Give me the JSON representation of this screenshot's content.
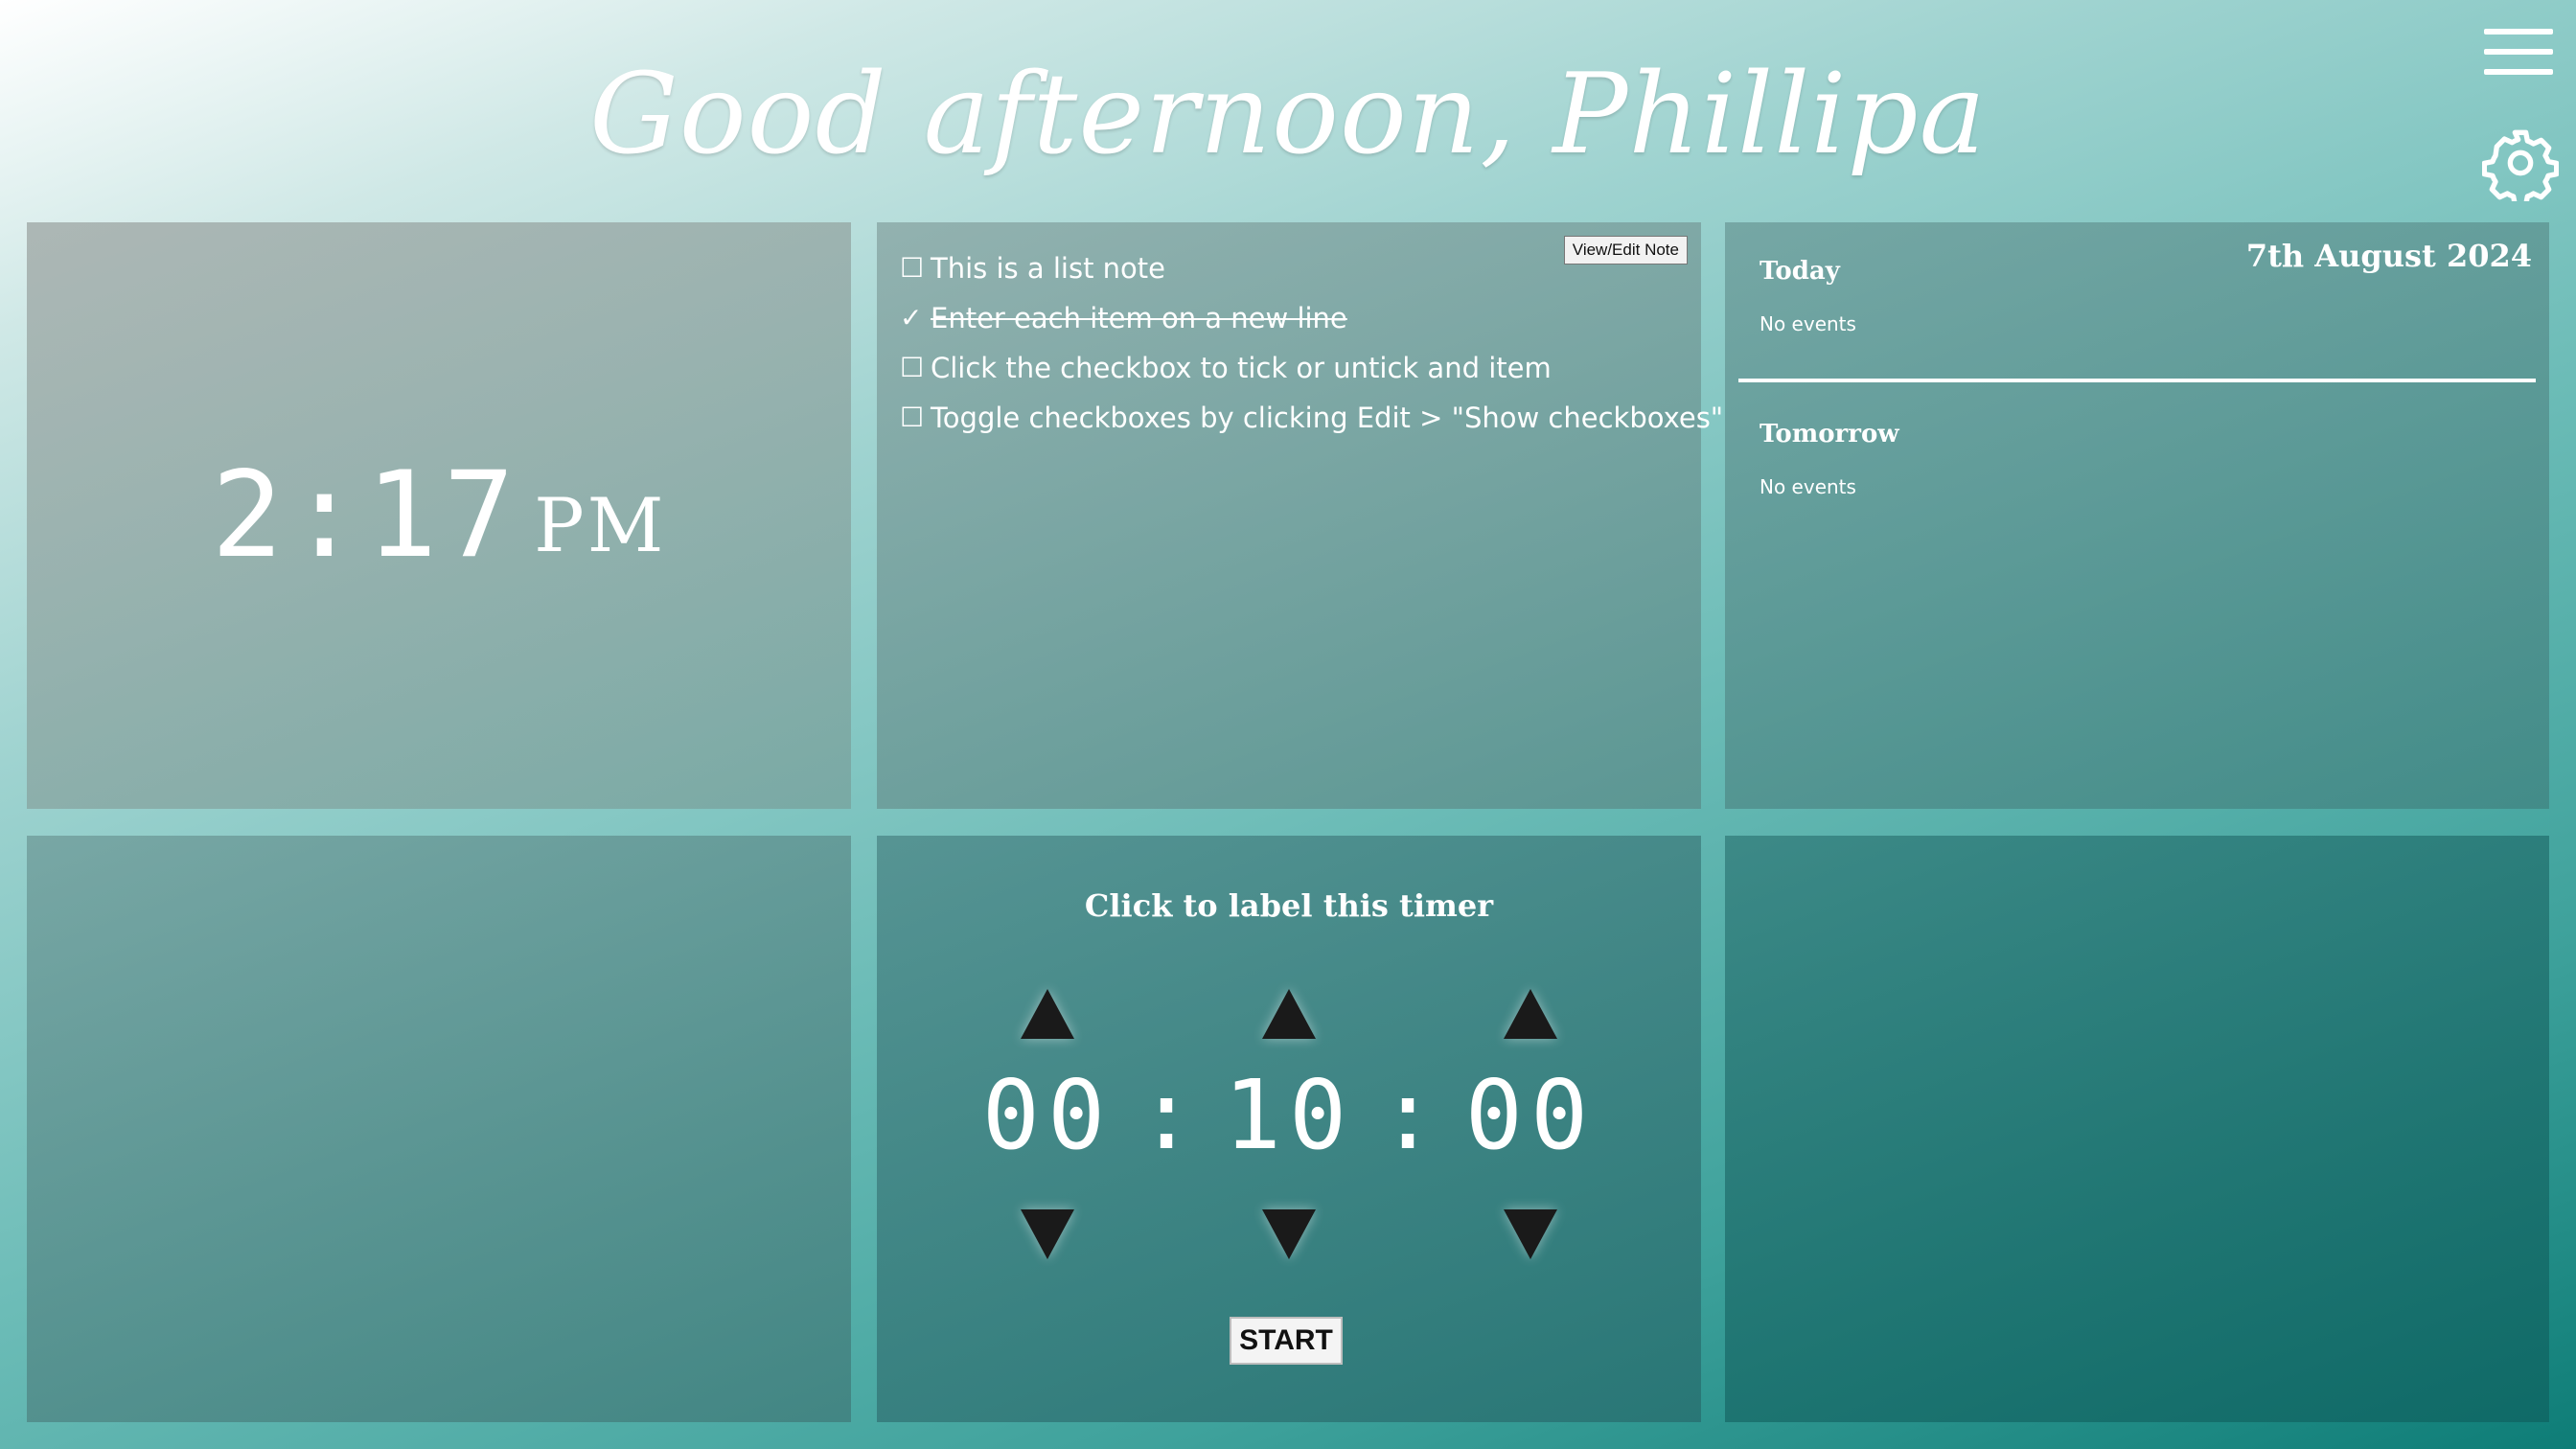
{
  "greeting": "Good afternoon, Phillipa",
  "header": {
    "menu_icon": "hamburger-menu-icon",
    "settings_icon": "gear-icon"
  },
  "clock": {
    "time": "2:17",
    "ampm": "PM"
  },
  "note": {
    "edit_label": "View/Edit Note",
    "items": [
      {
        "text": "This is a list note",
        "checked": false,
        "box": "☐"
      },
      {
        "text": "Enter each item on a new line",
        "checked": true,
        "box": "✓"
      },
      {
        "text": "Click the checkbox to tick or untick and item",
        "checked": false,
        "box": "☐"
      },
      {
        "text": "Toggle checkboxes by clicking Edit > \"Show checkboxes\"",
        "checked": false,
        "box": "☐"
      }
    ]
  },
  "calendar": {
    "date": "7th August 2024",
    "today_label": "Today",
    "today_events": "No events",
    "tomorrow_label": "Tomorrow",
    "tomorrow_events": "No events"
  },
  "timer": {
    "label": "Click to label this timer",
    "hours": "00",
    "minutes": "10",
    "seconds": "00",
    "separator": ":",
    "start_label": "START"
  },
  "colors": {
    "text": "#ffffff",
    "arrow": "#1a1a1a",
    "accent_dark": "#0e7d77"
  }
}
